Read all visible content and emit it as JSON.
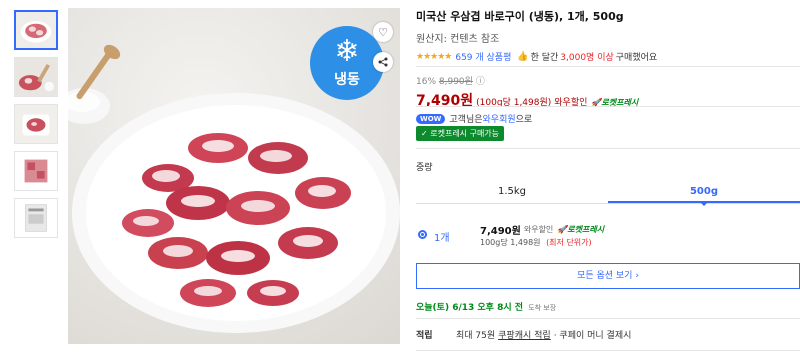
{
  "product": {
    "title": "미국산 우삼겹 바로구이 (냉동), 1개, 500g",
    "origin": "원산지: 컨텐츠 참조",
    "stars": "★★★★★",
    "review_count": "659 개 상품평",
    "bought_prefix": "한 달간",
    "bought_highlight": "3,000명 이상",
    "bought_suffix": "구매했어요"
  },
  "badge": {
    "label": "냉동",
    "icon": "snowflake-icon",
    "color": "#2d8fe6"
  },
  "price": {
    "discount_rate": "16%",
    "original_price": "8,990원",
    "info_icon": "ⓘ",
    "sale_price": "7,490원",
    "unit_price": "(100g당 1,498원)",
    "wow_label": "와우할인",
    "rocket_label": "로켓프레시"
  },
  "wow": {
    "pill": "WOW",
    "prefix": "고객님은",
    "link": "와우회원",
    "suffix": "으로"
  },
  "fresh_tag": "✓ 로켓프레시 구매가능",
  "options": {
    "weight_label": "중량",
    "tabs": [
      {
        "label": "1.5kg",
        "active": false
      },
      {
        "label": "500g",
        "active": true
      }
    ],
    "selected": {
      "qty": "1개",
      "price": "7,490원",
      "wow": "와우할인",
      "rocket": "로켓프레시",
      "unit": "100g당 1,498원",
      "lowest": "(최저 단위가)"
    },
    "all_button": "모든 옵션 보기 ›"
  },
  "delivery": {
    "text": "오늘(토) 6/13 오후 8시 전",
    "note": "도착 보장"
  },
  "points": {
    "label": "적립",
    "prefix": "최대 75원",
    "link": "쿠팡캐시 적립",
    "suffix": "· 쿠페이 머니 결제시"
  },
  "colors": {
    "accent": "#346aff",
    "price_red": "#ae0000",
    "rocket_green": "#00891a",
    "star": "#f5a623"
  }
}
